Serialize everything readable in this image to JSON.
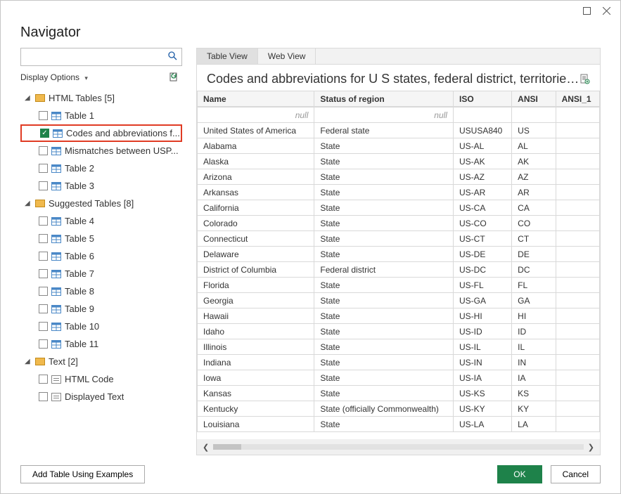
{
  "window": {
    "title": "Navigator"
  },
  "search": {
    "placeholder": ""
  },
  "display_options": {
    "label": "Display Options"
  },
  "tree": {
    "group_html": {
      "label": "HTML Tables [5]"
    },
    "group_suggested": {
      "label": "Suggested Tables [8]"
    },
    "group_text": {
      "label": "Text [2]"
    },
    "html_items": [
      {
        "label": "Table 1"
      },
      {
        "label": "Codes and abbreviations f..."
      },
      {
        "label": "Mismatches between USP..."
      },
      {
        "label": "Table 2"
      },
      {
        "label": "Table 3"
      }
    ],
    "suggested_items": [
      {
        "label": "Table 4"
      },
      {
        "label": "Table 5"
      },
      {
        "label": "Table 6"
      },
      {
        "label": "Table 7"
      },
      {
        "label": "Table 8"
      },
      {
        "label": "Table 9"
      },
      {
        "label": "Table 10"
      },
      {
        "label": "Table 11"
      }
    ],
    "text_items": [
      {
        "label": "HTML Code"
      },
      {
        "label": "Displayed Text"
      }
    ]
  },
  "tabs": {
    "table_view": "Table View",
    "web_view": "Web View"
  },
  "preview_title": "Codes and abbreviations for U S states, federal district, territories,...",
  "columns": [
    "Name",
    "Status of region",
    "ISO",
    "ANSI",
    "ANSI_1"
  ],
  "null_label": "null",
  "rows": [
    [
      "United States of America",
      "Federal state",
      "USUSA840",
      "US",
      ""
    ],
    [
      "Alabama",
      "State",
      "US-AL",
      "AL",
      ""
    ],
    [
      "Alaska",
      "State",
      "US-AK",
      "AK",
      ""
    ],
    [
      "Arizona",
      "State",
      "US-AZ",
      "AZ",
      ""
    ],
    [
      "Arkansas",
      "State",
      "US-AR",
      "AR",
      ""
    ],
    [
      "California",
      "State",
      "US-CA",
      "CA",
      ""
    ],
    [
      "Colorado",
      "State",
      "US-CO",
      "CO",
      ""
    ],
    [
      "Connecticut",
      "State",
      "US-CT",
      "CT",
      ""
    ],
    [
      "Delaware",
      "State",
      "US-DE",
      "DE",
      ""
    ],
    [
      "District of Columbia",
      "Federal district",
      "US-DC",
      "DC",
      ""
    ],
    [
      "Florida",
      "State",
      "US-FL",
      "FL",
      ""
    ],
    [
      "Georgia",
      "State",
      "US-GA",
      "GA",
      ""
    ],
    [
      "Hawaii",
      "State",
      "US-HI",
      "HI",
      ""
    ],
    [
      "Idaho",
      "State",
      "US-ID",
      "ID",
      ""
    ],
    [
      "Illinois",
      "State",
      "US-IL",
      "IL",
      ""
    ],
    [
      "Indiana",
      "State",
      "US-IN",
      "IN",
      ""
    ],
    [
      "Iowa",
      "State",
      "US-IA",
      "IA",
      ""
    ],
    [
      "Kansas",
      "State",
      "US-KS",
      "KS",
      ""
    ],
    [
      "Kentucky",
      "State (officially Commonwealth)",
      "US-KY",
      "KY",
      ""
    ],
    [
      "Louisiana",
      "State",
      "US-LA",
      "LA",
      ""
    ]
  ],
  "footer": {
    "add_examples": "Add Table Using Examples",
    "ok": "OK",
    "cancel": "Cancel"
  }
}
